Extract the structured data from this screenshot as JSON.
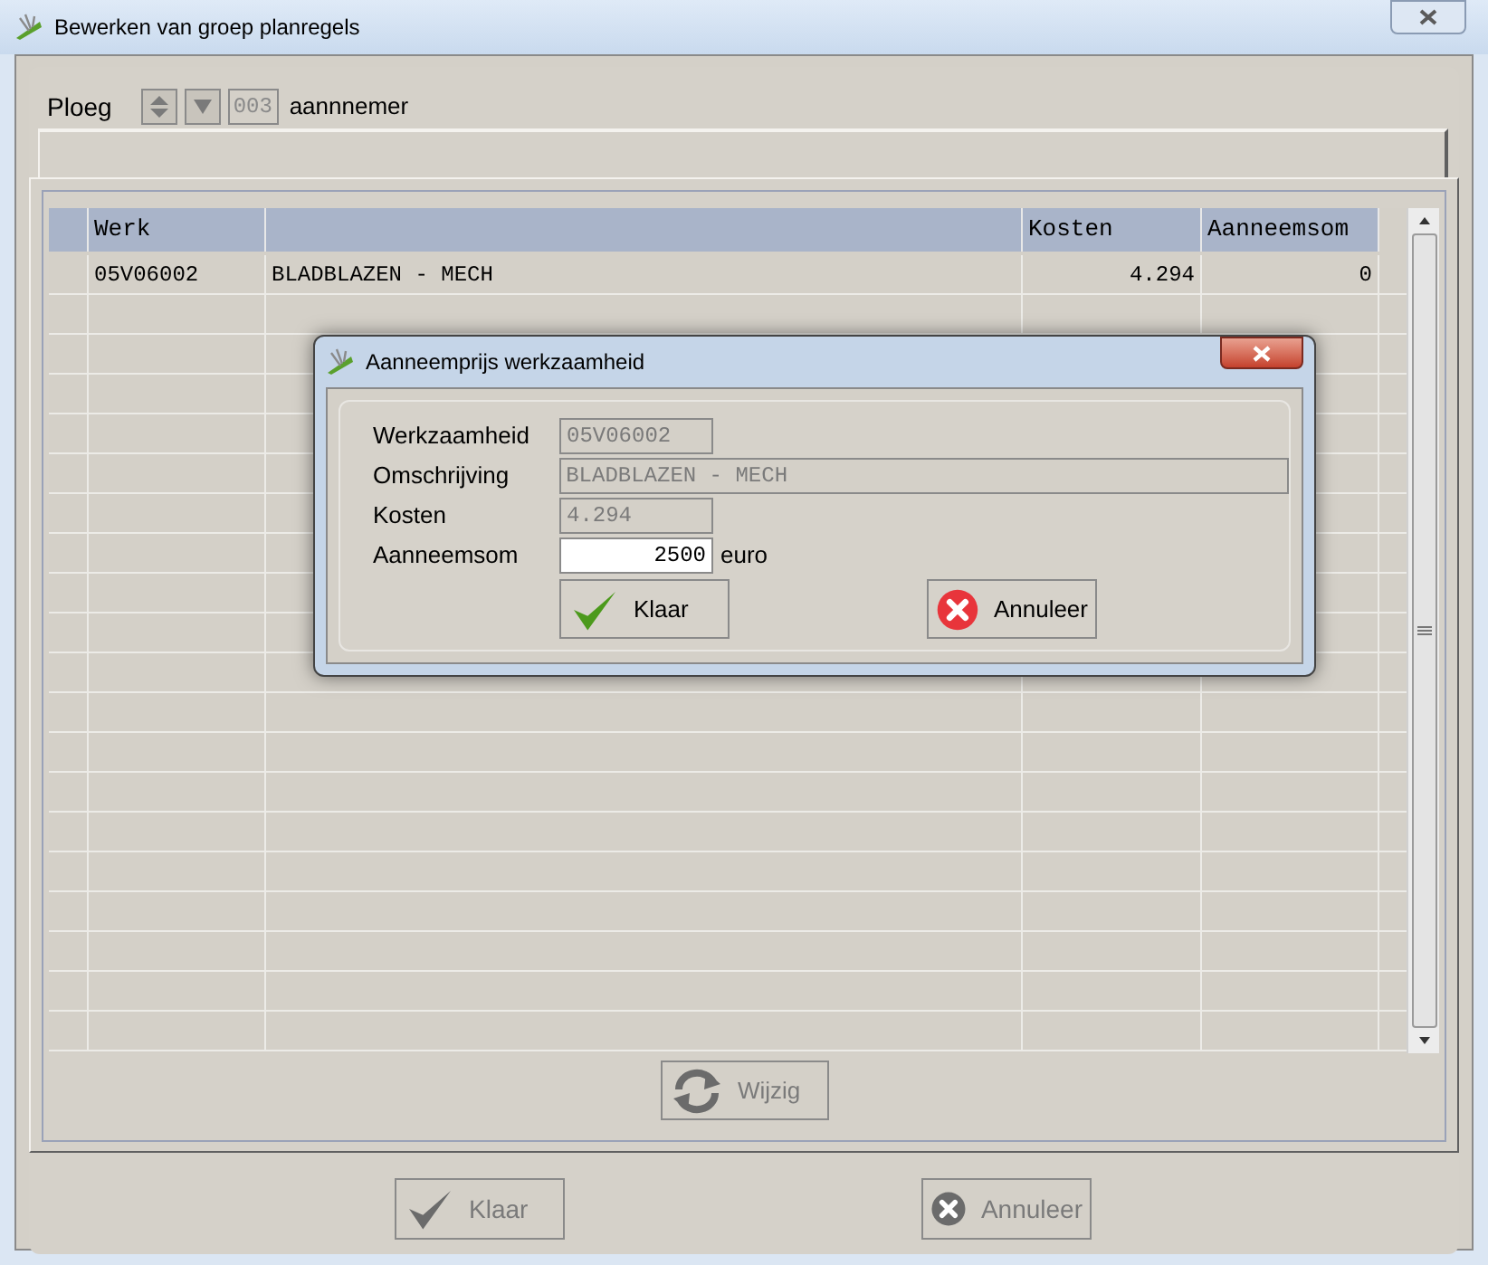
{
  "window": {
    "title": "Bewerken van groep planregels"
  },
  "ploeg": {
    "label": "Ploeg",
    "value": "003",
    "disabled": true,
    "suffix": "aannnemer"
  },
  "table": {
    "columns": [
      "",
      "Werk",
      "",
      "Kosten",
      "Aanneemsom"
    ],
    "rows": [
      [
        "",
        "05V06002",
        "BLADBLAZEN - MECH",
        "4.294",
        "0"
      ]
    ]
  },
  "wijzig_button": {
    "label": "Wijzig",
    "disabled": true
  },
  "buttons": [
    {
      "kind": "ok",
      "label": "Klaar",
      "disabled": true
    },
    {
      "kind": "cancel",
      "label": "Annuleer",
      "disabled": true
    }
  ],
  "dialog": {
    "title": "Aanneemprijs werkzaamheid",
    "fields": [
      {
        "label": "Werkzaamheid",
        "value": "05V06002",
        "disabled": true,
        "wide": false
      },
      {
        "label": "Omschrijving",
        "value": "BLADBLAZEN - MECH",
        "disabled": true,
        "wide": true
      },
      {
        "label": "Kosten",
        "value": "4.294",
        "disabled": true,
        "wide": false
      },
      {
        "label": "Aanneemsom",
        "value": "2500",
        "disabled": false,
        "wide": false,
        "unit": "euro"
      }
    ],
    "buttons": [
      {
        "kind": "ok",
        "label": "Klaar",
        "disabled": false
      },
      {
        "kind": "cancel",
        "label": "Annuleer",
        "disabled": false
      }
    ]
  }
}
